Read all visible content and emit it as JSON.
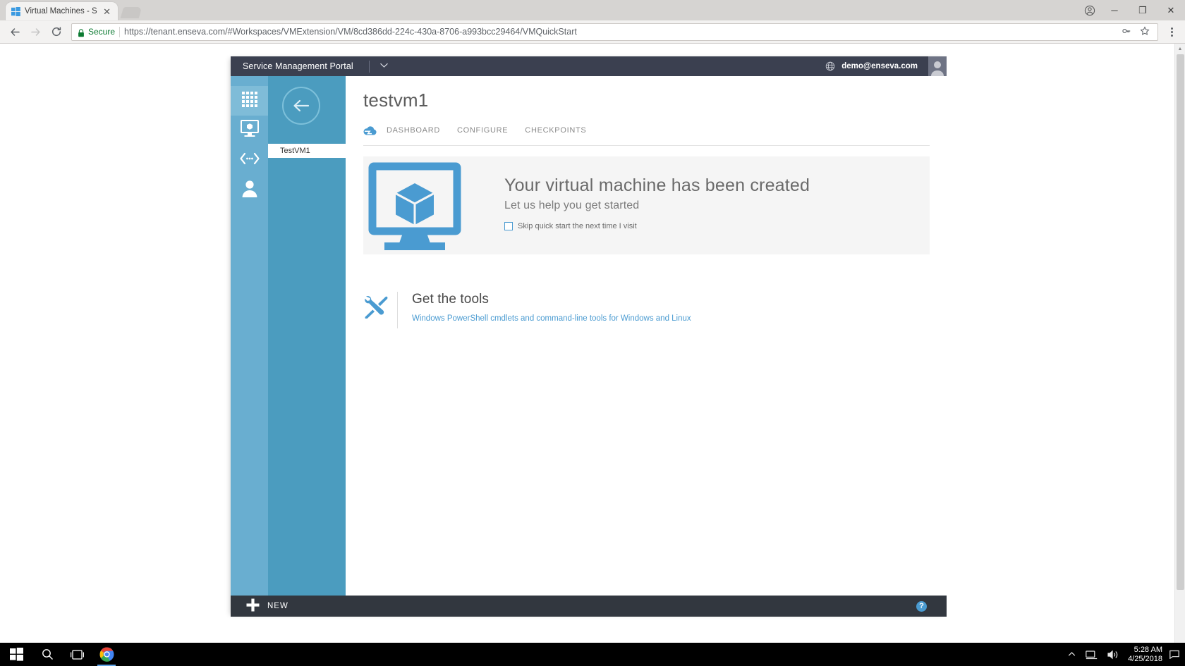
{
  "browser": {
    "tab": {
      "title": "Virtual Machines - Servic",
      "favicon_icon": "windows-logo-icon",
      "close_icon": "close-icon"
    },
    "new_tab_icon": "new-tab-icon",
    "window_controls": {
      "profile_icon": "profile-icon",
      "minimize": "─",
      "maximize": "❐",
      "close": "✕"
    },
    "toolbar": {
      "back_icon": "back-arrow-icon",
      "forward_icon": "forward-arrow-icon",
      "reload_icon": "reload-icon",
      "lock_icon": "lock-icon",
      "secure_label": "Secure",
      "url_scheme": "https://",
      "url_host": "tenant.enseva.com",
      "url_path": "/#Workspaces/VMExtension/VM/8cd386dd-224c-430a-8706-a993bcc29464/VMQuickStart",
      "url_full": "https://tenant.enseva.com/#Workspaces/VMExtension/VM/8cd386dd-224c-430a-8706-a993bcc29464/VMQuickStart",
      "key_icon": "key-icon",
      "star_icon": "star-icon",
      "menu_icon": "overflow-menu-icon"
    }
  },
  "portal": {
    "brand": "Service Management Portal",
    "brand_caret_icon": "chevron-down-icon",
    "globe_icon": "globe-icon",
    "user_email": "demo@enseva.com",
    "avatar_icon": "user-avatar-icon",
    "rail": [
      {
        "name": "all-items",
        "icon": "grid-icon",
        "active": true
      },
      {
        "name": "virtual-machines",
        "icon": "monitor-vm-icon",
        "active": false
      },
      {
        "name": "networks",
        "icon": "network-icon",
        "active": false
      },
      {
        "name": "user-accounts",
        "icon": "person-icon",
        "active": false
      }
    ],
    "subnav": {
      "back_icon": "back-circle-arrow-icon",
      "item_label": "TestVM1"
    },
    "page_title": "testvm1",
    "tabs_cloud_icon": "cloud-icon",
    "tabs": [
      {
        "label": "DASHBOARD",
        "selected": true
      },
      {
        "label": "CONFIGURE",
        "selected": false
      },
      {
        "label": "CHECKPOINTS",
        "selected": false
      }
    ],
    "hero": {
      "art_icon": "monitor-cube-icon",
      "heading": "Your virtual machine has been created",
      "subheading": "Let us help you get started",
      "checkbox_label": "Skip quick start the next time I visit",
      "checkbox_checked": false
    },
    "tools": {
      "icon": "wrench-screwdriver-icon",
      "heading": "Get the tools",
      "link": "Windows PowerShell cmdlets and command-line tools for Windows and Linux"
    },
    "footer": {
      "new_icon": "plus-icon",
      "new_label": "NEW",
      "help_icon": "help-icon",
      "help_label": "?"
    },
    "colors": {
      "accent_blue": "#4a9bd1",
      "rail_blue": "#69aed0",
      "subnav_blue": "#4b9cbf",
      "topbar_dark": "#3b4050",
      "footer_dark": "#32373f"
    }
  },
  "scrollbar": {
    "up_arrow": "▲",
    "down_arrow": "▼"
  },
  "taskbar": {
    "start_icon": "windows-start-icon",
    "search_icon": "search-icon",
    "taskview_icon": "task-view-icon",
    "chrome_icon": "chrome-icon",
    "tray_chevron_icon": "show-hidden-icons-icon",
    "tray_network_icon": "network-tray-icon",
    "tray_volume_icon": "volume-icon",
    "clock_time": "5:28 AM",
    "clock_date": "4/25/2018",
    "action_center_icon": "action-center-icon"
  }
}
